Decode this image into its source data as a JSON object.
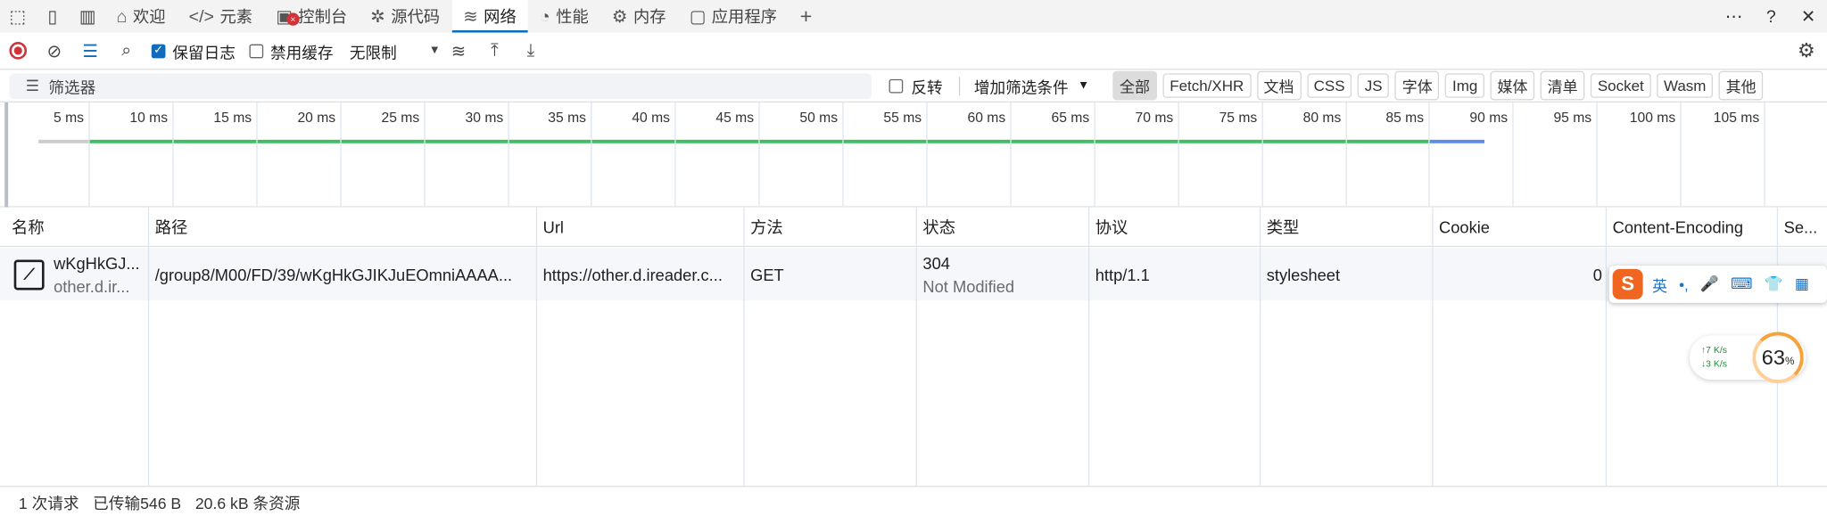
{
  "tabs": [
    {
      "label": "欢迎",
      "icon": "home-icon"
    },
    {
      "label": "元素",
      "icon": "code-icon"
    },
    {
      "label": "控制台",
      "icon": "console-icon"
    },
    {
      "label": "源代码",
      "icon": "bug-icon"
    },
    {
      "label": "网络",
      "icon": "wifi-icon"
    },
    {
      "label": "性能",
      "icon": "gauge-icon"
    },
    {
      "label": "内存",
      "icon": "chip-icon"
    },
    {
      "label": "应用程序",
      "icon": "app-window-icon"
    }
  ],
  "toolbar": {
    "preserve_log": "保留日志",
    "disable_cache": "禁用缓存",
    "throttle": "无限制"
  },
  "filter": {
    "placeholder": "筛选器",
    "invert": "反转",
    "add_filter": "增加筛选条件",
    "chips": [
      "全部",
      "Fetch/XHR",
      "文档",
      "CSS",
      "JS",
      "字体",
      "Img",
      "媒体",
      "清单",
      "Socket",
      "Wasm",
      "其他"
    ]
  },
  "timeline": {
    "ticks": [
      "5 ms",
      "10 ms",
      "15 ms",
      "20 ms",
      "25 ms",
      "30 ms",
      "35 ms",
      "40 ms",
      "45 ms",
      "50 ms",
      "55 ms",
      "60 ms",
      "65 ms",
      "70 ms",
      "75 ms",
      "80 ms",
      "85 ms",
      "90 ms",
      "95 ms",
      "100 ms",
      "105 ms",
      "11"
    ],
    "colors": {
      "waiting": "#cccccc",
      "download": "#3fbf5f",
      "end": "#5b8de6"
    }
  },
  "columns": [
    "名称",
    "路径",
    "Url",
    "方法",
    "状态",
    "协议",
    "类型",
    "Cookie",
    "Content-Encoding",
    "Se..."
  ],
  "request": {
    "name": "wKgHkGJ...",
    "domain": "other.d.ir...",
    "path": "/group8/M00/FD/39/wKgHkGJIKJuEOmniAAAA...",
    "url": "https://other.d.ireader.c...",
    "method": "GET",
    "status_code": "304",
    "status_text": "Not Modified",
    "protocol": "http/1.1",
    "type": "stylesheet",
    "cookie": "0",
    "overflow": "W"
  },
  "status": {
    "requests": "1 次请求",
    "transferred": "已传输546 B",
    "resources": "20.6 kB 条资源"
  },
  "ime": {
    "lang": "英",
    "punct": "•,"
  },
  "speed": {
    "up": "↑7  K/s",
    "down": "↓3  K/s",
    "percent": "63",
    "percent_sign": "%"
  }
}
